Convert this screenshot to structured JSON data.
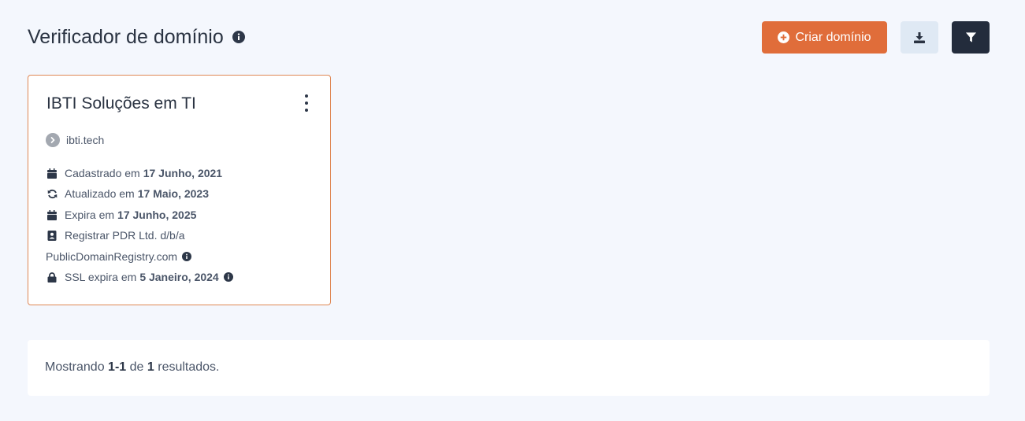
{
  "header": {
    "title": "Verificador de domínio",
    "create_label": "Criar domínio"
  },
  "icons": {
    "title_info": "info-circle-icon",
    "create": "plus-circle-icon",
    "download": "download-icon",
    "filter": "filter-icon"
  },
  "colors": {
    "accent": "#e06d3a",
    "dark_button": "#232c3c",
    "light_button": "#dfe9f4",
    "card_border": "#df8754",
    "background": "#f4f7fd"
  },
  "card": {
    "title": "IBTI Soluções em TI",
    "domain": "ibti.tech",
    "registered_label": "Cadastrado em",
    "registered_date": "17 Junho, 2021",
    "updated_label": "Atualizado em",
    "updated_date": "17 Maio, 2023",
    "expires_label": "Expira em",
    "expires_date": "17 Junho, 2025",
    "registrar_line1": "Registrar PDR Ltd. d/b/a",
    "registrar_line2": "PublicDomainRegistry.com",
    "ssl_label": "SSL expira em",
    "ssl_date": "5 Janeiro, 2024"
  },
  "footer": {
    "prefix": "Mostrando",
    "range": "1-1",
    "middle": "de",
    "total": "1",
    "suffix": "resultados."
  }
}
